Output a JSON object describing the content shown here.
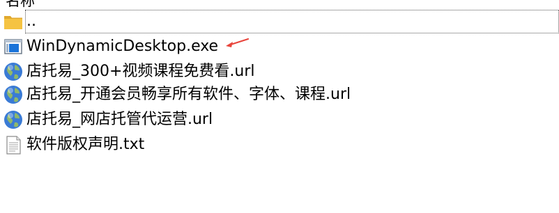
{
  "header": {
    "name_column": "名称"
  },
  "files": [
    {
      "name": "..",
      "icon": "folder-icon"
    },
    {
      "name": "WinDynamicDesktop.exe",
      "icon": "exe-app-icon"
    },
    {
      "name": "店托易_300+视频课程免费看.url",
      "icon": "globe-url-icon"
    },
    {
      "name": "店托易_开通会员畅享所有软件、字体、课程.url",
      "icon": "globe-url-icon"
    },
    {
      "name": "店托易_网店托管代运营.url",
      "icon": "globe-url-icon"
    },
    {
      "name": "软件版权声明.txt",
      "icon": "text-file-icon"
    }
  ],
  "colors": {
    "folder": "#f5c342",
    "arrow": "#e8453c",
    "globe": "#3a7bd5"
  }
}
